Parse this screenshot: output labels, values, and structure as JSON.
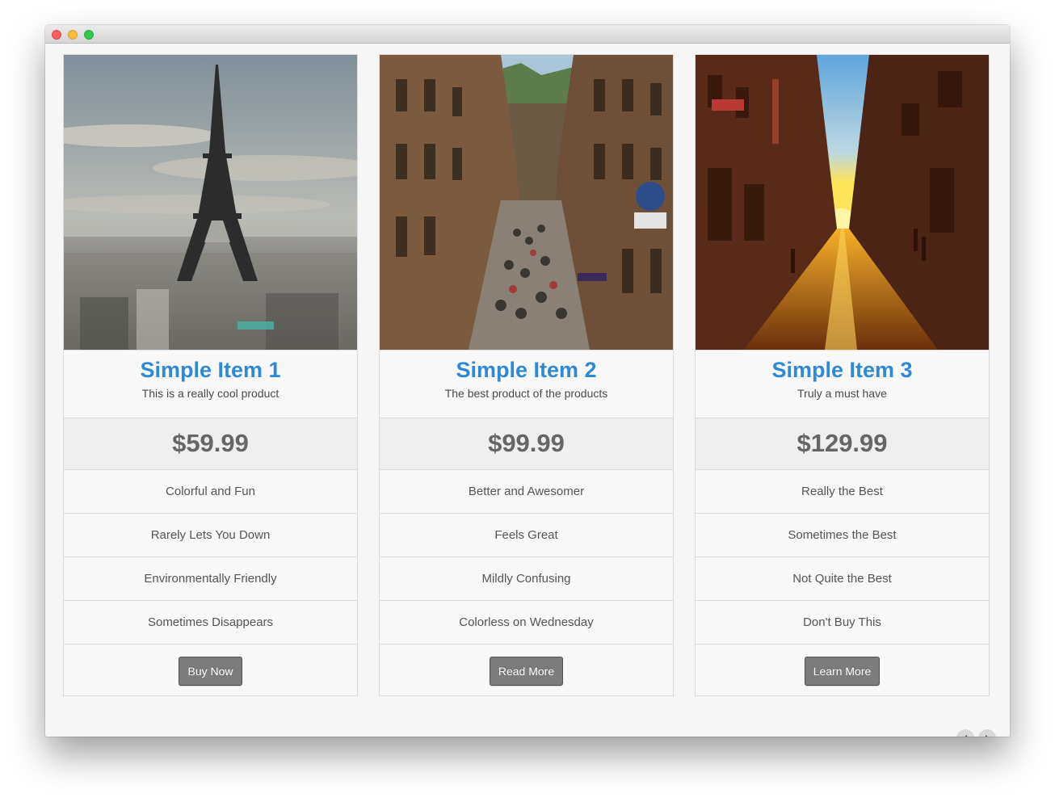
{
  "carousel": {
    "cards": [
      {
        "title": "Simple Item 1",
        "subtitle": "This is a really cool product",
        "price": "$59.99",
        "features": [
          "Colorful and Fun",
          "Rarely Lets You Down",
          "Environmentally Friendly",
          "Sometimes Disappears"
        ],
        "button": "Buy Now",
        "image": "eiffel-tower-photo"
      },
      {
        "title": "Simple Item 2",
        "subtitle": "The best product of the products",
        "price": "$99.99",
        "features": [
          "Better and Awesomer",
          "Feels Great",
          "Mildly Confusing",
          "Colorless on Wednesday"
        ],
        "button": "Read More",
        "image": "crowded-street-photo"
      },
      {
        "title": "Simple Item 3",
        "subtitle": "Truly a must have",
        "price": "$129.99",
        "features": [
          "Really the Best",
          "Sometimes the Best",
          "Not Quite the Best",
          "Don't Buy This"
        ],
        "button": "Learn More",
        "image": "sunset-street-photo"
      }
    ],
    "pagination": {
      "pages": 2,
      "active": 1
    },
    "colors": {
      "title": "#2f8ad3",
      "button": "#7c7c7c",
      "price_bg": "#efefef"
    }
  },
  "window": {
    "controls": [
      "close-icon",
      "minimize-icon",
      "maximize-icon"
    ],
    "nav": [
      "chevron-left-icon",
      "chevron-right-icon"
    ]
  }
}
